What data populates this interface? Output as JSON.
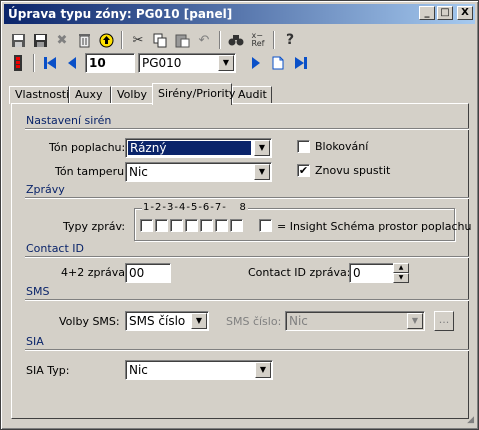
{
  "window": {
    "title": "Úprava typu zóny: PG010 [panel]"
  },
  "titlebar_buttons": {
    "minimize": "_",
    "maximize": "□",
    "close": "X"
  },
  "nav": {
    "number_value": "10",
    "zone_value": "PG010"
  },
  "tabs": [
    {
      "label": "Vlastnosti"
    },
    {
      "label": "Auxy"
    },
    {
      "label": "Volby"
    },
    {
      "label": "Sirény/Priority"
    },
    {
      "label": "Audit"
    }
  ],
  "sections": {
    "sirens": "Nastavení sirén",
    "messages": "Zprávy",
    "contact_id": "Contact ID",
    "sms": "SMS",
    "sia": "SIA"
  },
  "sirens": {
    "alarm_tone_label": "Tón poplachu:",
    "alarm_tone_value": "Rázný",
    "tamper_tone_label": "Tón tamperu:",
    "tamper_tone_value": "Nic",
    "block_label": "Blokování",
    "block_checked": false,
    "restart_label": "Znovu spustit",
    "restart_checked": true
  },
  "messages": {
    "types_label": "Typy zpráv:",
    "numbers": [
      "1",
      "2",
      "3",
      "4",
      "5",
      "6",
      "7",
      "8"
    ],
    "insight_label": "= Insight Schéma prostor poplachu"
  },
  "contact_id": {
    "msg42_label": "4+2 zpráva:",
    "msg42_value": "00",
    "cid_label": "Contact ID zpráva:",
    "cid_value": "0"
  },
  "sms": {
    "options_label": "Volby SMS:",
    "options_value": "SMS číslo",
    "number_label": "SMS číslo:",
    "number_value": "Nic",
    "browse_label": "..."
  },
  "sia": {
    "type_label": "SIA Typ:",
    "type_value": "Nic"
  }
}
